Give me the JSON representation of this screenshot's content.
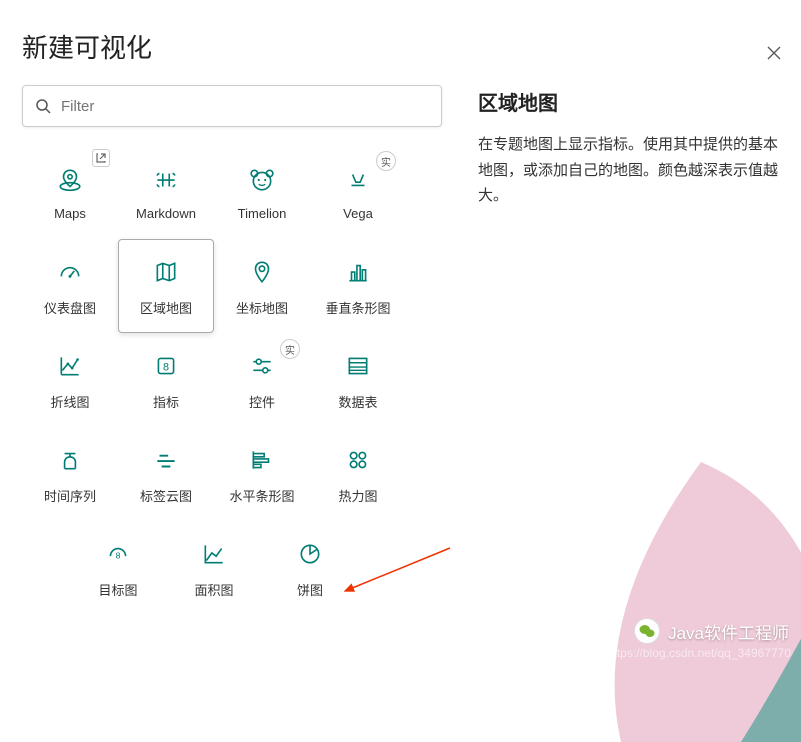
{
  "title": "新建可视化",
  "search": {
    "placeholder": "Filter"
  },
  "tiles": {
    "row1": [
      {
        "label": "Maps",
        "icon": "maps",
        "corner": true
      },
      {
        "label": "Markdown",
        "icon": "markdown"
      },
      {
        "label": "Timelion",
        "icon": "timelion"
      },
      {
        "label": "Vega",
        "icon": "vega",
        "badge": "实"
      }
    ],
    "row2": [
      {
        "label": "仪表盘图",
        "icon": "gauge"
      },
      {
        "label": "区域地图",
        "icon": "regionmap",
        "selected": true
      },
      {
        "label": "坐标地图",
        "icon": "coordmap"
      },
      {
        "label": "垂直条形图",
        "icon": "vbar"
      }
    ],
    "row3": [
      {
        "label": "折线图",
        "icon": "line"
      },
      {
        "label": "指标",
        "icon": "metric"
      },
      {
        "label": "控件",
        "icon": "controls",
        "badge": "实"
      },
      {
        "label": "数据表",
        "icon": "table"
      }
    ],
    "row4": [
      {
        "label": "时间序列",
        "icon": "tsvb"
      },
      {
        "label": "标签云图",
        "icon": "tagcloud"
      },
      {
        "label": "水平条形图",
        "icon": "hbar"
      },
      {
        "label": "热力图",
        "icon": "heatmap"
      }
    ],
    "row5": [
      {
        "label": "目标图",
        "icon": "goal"
      },
      {
        "label": "面积图",
        "icon": "area"
      },
      {
        "label": "饼图",
        "icon": "pie"
      }
    ]
  },
  "detail": {
    "title": "区域地图",
    "description": "在专题地图上显示指标。使用其中提供的基本地图，或添加自己的地图。颜色越深表示值越大。"
  },
  "watermark": {
    "text": "Java软件工程师",
    "url": "https://blog.csdn.net/qq_34967770"
  }
}
